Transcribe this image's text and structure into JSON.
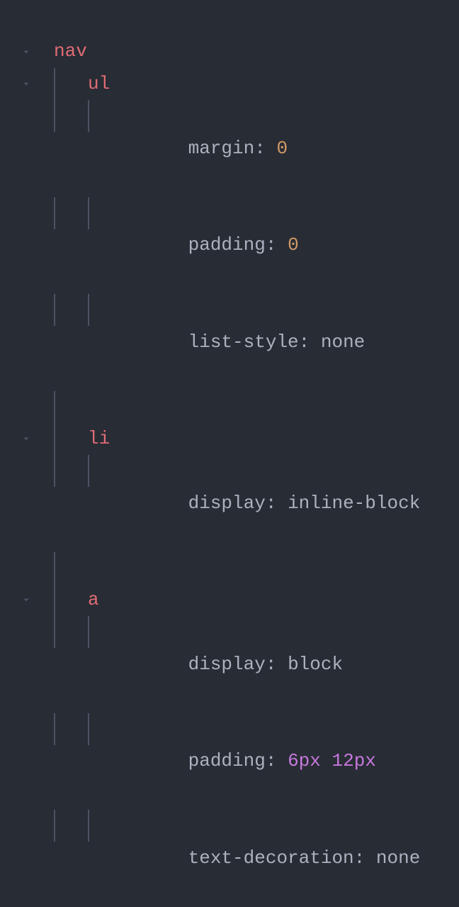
{
  "code": {
    "selectors": {
      "nav": "nav",
      "ul": "ul",
      "li": "li",
      "a": "a"
    },
    "props": {
      "margin": "margin",
      "padding": "padding",
      "list_style": "list-style",
      "display": "display",
      "text_decoration": "text-decoration"
    },
    "values": {
      "zero": "0",
      "none": "none",
      "inline_block": "inline-block",
      "block": "block",
      "six_px": "6px",
      "twelve_px": "12px"
    },
    "punctuation": {
      "colon_space": ": ",
      "space": " "
    }
  }
}
